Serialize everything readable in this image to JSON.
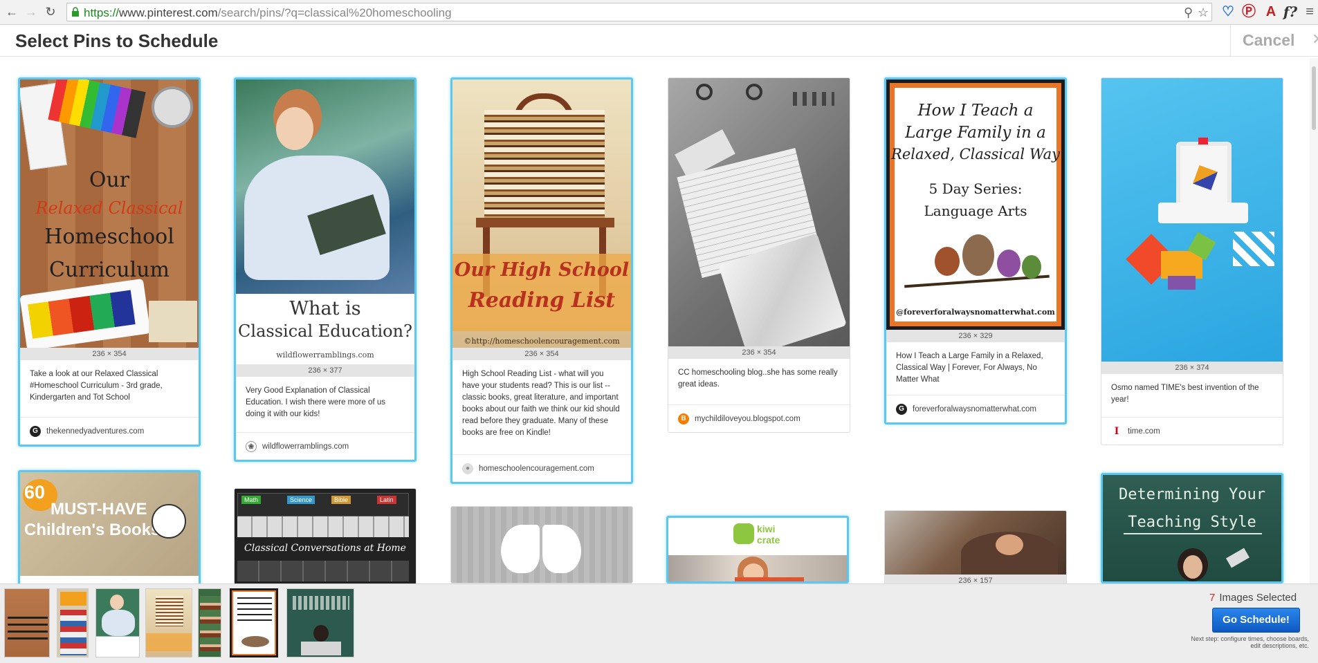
{
  "browser": {
    "url_scheme": "https://",
    "url_host": "www.pinterest.com",
    "url_path": "/search/pins/?q=classical%20homeschooling",
    "icons": [
      "back-icon",
      "forward-icon",
      "reload-icon",
      "lock-icon",
      "zoom-icon",
      "star-icon",
      "pinterest-icon",
      "acrobat-icon",
      "font-icon",
      "menu-icon"
    ]
  },
  "header": {
    "title": "Select Pins to Schedule",
    "cancel": "Cancel"
  },
  "pins": [
    {
      "dims": "236 × 354",
      "desc": "Take a look at our Relaxed Classical #Homeschool Curriculum - 3rd grade, Kindergarten and Tot School",
      "source": "thekennedyadventures.com",
      "img": {
        "l1": "Our",
        "l2": "Relaxed Classical",
        "l3": "Homeschool",
        "l4": "Curriculum"
      }
    },
    {
      "dims": "236 × 377",
      "desc": "Very Good Explanation of Classical Education. I wish there were more of us doing it with our kids!",
      "source": "wildflowerramblings.com",
      "img": {
        "l1": "What is",
        "l2": "Classical Education?",
        "l3": "wildflowerramblings.com"
      }
    },
    {
      "dims": "236 × 354",
      "desc": "High School Reading List - what will you have your students read? This is our list -- classic books, great literature, and important books about our faith we think our kid should read before they graduate. Many of these books are free on Kindle!",
      "source": "homeschoolencouragement.com",
      "img": {
        "l1": "Our High School",
        "l2": "Reading List",
        "l3": "©http://homeschoolencouragement.com"
      }
    },
    {
      "dims": "236 × 354",
      "desc": "CC homeschooling blog..she has some really great ideas.",
      "source": "mychildiloveyou.blogspot.com"
    },
    {
      "dims": "236 × 329",
      "desc": "How I Teach a Large Family in a Relaxed, Classical Way | Forever, For Always, No Matter What",
      "source": "foreverforalwaysnomatterwhat.com",
      "img": {
        "l1": "How I Teach a",
        "l2": "Large Family in a",
        "l3": "Relaxed, Classical Way",
        "l4": "5 Day Series:",
        "l5": "Language Arts",
        "l6": "@foreverforalwaysnomatterwhat.com"
      }
    },
    {
      "dims": "236 × 374",
      "desc": "Osmo named TIME's best invention of the year!",
      "source": "time.com"
    }
  ],
  "row2": {
    "books_pin": {
      "l1": "60",
      "l2": "MUST-HAVE",
      "l3": "Children's Books"
    },
    "conversations_pin": {
      "l1": "Classical Conversations at Home",
      "tabs": [
        "Math",
        "Science",
        "Bible",
        "Latin"
      ]
    },
    "kiwi_pin": {
      "l1": "kiwi",
      "l2": "crate"
    },
    "pottery_pin": {
      "dims": "236 × 157"
    },
    "teaching_pin": {
      "l1": "Determining Your",
      "l2": "Teaching Style"
    }
  },
  "tray": {
    "count": "7",
    "count_label": "Images Selected",
    "button": "Go Schedule!",
    "next_step": "Next step: configure times, choose boards, edit descriptions, etc."
  },
  "colors": {
    "selected_border": "#5cc8ef",
    "button_blue": "#1a6dd8",
    "count_red": "#d02828"
  }
}
